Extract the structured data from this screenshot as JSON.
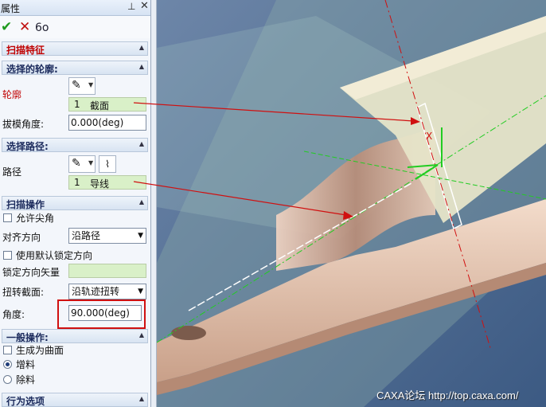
{
  "panel": {
    "title": "属性",
    "pin_icon": "⊥",
    "close_icon": "✕"
  },
  "toolbar": {
    "ok_icon": "✔",
    "cancel_icon": "✕",
    "preview_icon": "6o",
    "ok_color": "#1e9a1e",
    "cancel_color": "#c01010"
  },
  "sections": {
    "sweep_feature": "扫描特征",
    "profile": "选择的轮廓:",
    "path": "选择路径:",
    "sweep_ops": "扫描操作",
    "general_ops": "一般操作:",
    "behavior": "行为选项"
  },
  "profile": {
    "label": "轮廓",
    "item_no": "1",
    "item_name": "截面",
    "draft_label": "拔模角度:",
    "draft_value": "0.000(deg)"
  },
  "path": {
    "label": "路径",
    "item_no": "1",
    "item_name": "导线"
  },
  "sweep_ops": {
    "allow_sharp": "允许尖角",
    "align_label": "对齐方向",
    "align_value": "沿路径",
    "use_default_lock": "使用默认锁定方向",
    "lock_vector_label": "锁定方向矢量",
    "twist_label": "扭转截面:",
    "twist_value": "沿轨迹扭转",
    "angle_label": "角度:",
    "angle_value": "90.000(deg)"
  },
  "general_ops": {
    "make_surface": "生成为曲面",
    "add": "增料",
    "remove": "除料",
    "selected": "add"
  },
  "viewport": {
    "watermark": "CAXA论坛 http://top.caxa.com/"
  },
  "colors": {
    "accent_red": "#d01010",
    "section_title_red": "#c00000",
    "field_green": "#d9f0c8",
    "part_fill": "#e8c6b2"
  }
}
